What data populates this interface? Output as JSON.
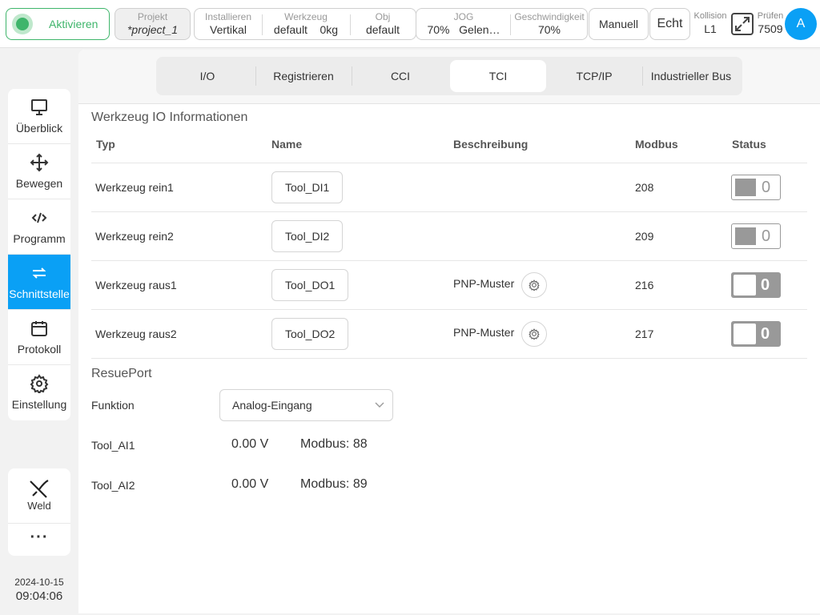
{
  "topbar": {
    "activate_label": "Aktivieren",
    "project": {
      "key": "Projekt",
      "value": "*project_1"
    },
    "install": [
      {
        "key": "Installieren",
        "value": "Vertikal"
      },
      {
        "key": "Werkzeug",
        "value": "default    0kg"
      },
      {
        "key": "Obj",
        "value": "default"
      }
    ],
    "jog": [
      {
        "key": "JOG",
        "value": "70%   Gelen…"
      },
      {
        "key": "Geschwindigkeit",
        "value": "70%"
      }
    ],
    "mode_button": "Manuell",
    "real_button": "Echt",
    "collision": {
      "key": "Kollision",
      "value": "L1"
    },
    "check": {
      "key": "Prüfen",
      "value": "7509"
    },
    "avatar": "A"
  },
  "sidebar": {
    "items": [
      {
        "label": "Überblick",
        "icon": "monitor-icon"
      },
      {
        "label": "Bewegen",
        "icon": "move-icon"
      },
      {
        "label": "Programm",
        "icon": "code-icon"
      },
      {
        "label": "Schnittstelle",
        "icon": "interface-icon"
      },
      {
        "label": "Protokoll",
        "icon": "calendar-icon"
      },
      {
        "label": "Einstellung",
        "icon": "gear-icon"
      }
    ],
    "active": "Schnittstelle",
    "weld_label": "Weld",
    "more_label": "···",
    "date": "2024-10-15",
    "time": "09:04:06"
  },
  "tabs": [
    "I/O",
    "Registrieren",
    "CCI",
    "TCI",
    "TCP/IP",
    "Industrieller Bus"
  ],
  "active_tab": "TCI",
  "io_section": {
    "title": "Werkzeug IO Informationen",
    "columns": [
      "Typ",
      "Name",
      "Beschreibung",
      "Modbus",
      "Status"
    ],
    "rows": [
      {
        "type": "Werkzeug rein1",
        "name": "Tool_DI1",
        "description": "",
        "modbus": "208",
        "status": "0"
      },
      {
        "type": "Werkzeug rein2",
        "name": "Tool_DI2",
        "description": "",
        "modbus": "209",
        "status": "0"
      },
      {
        "type": "Werkzeug raus1",
        "name": "Tool_DO1",
        "description": "PNP-Muster",
        "modbus": "216",
        "status": "0"
      },
      {
        "type": "Werkzeug raus2",
        "name": "Tool_DO2",
        "description": "PNP-Muster",
        "modbus": "217",
        "status": "0"
      }
    ]
  },
  "resue": {
    "title": "ResuePort",
    "function_label": "Funktion",
    "function_value": "Analog-Eingang",
    "analog": [
      {
        "name": "Tool_AI1",
        "value": "0.00 V",
        "modbus": "Modbus: 88"
      },
      {
        "name": "Tool_AI2",
        "value": "0.00 V",
        "modbus": "Modbus: 89"
      }
    ]
  }
}
